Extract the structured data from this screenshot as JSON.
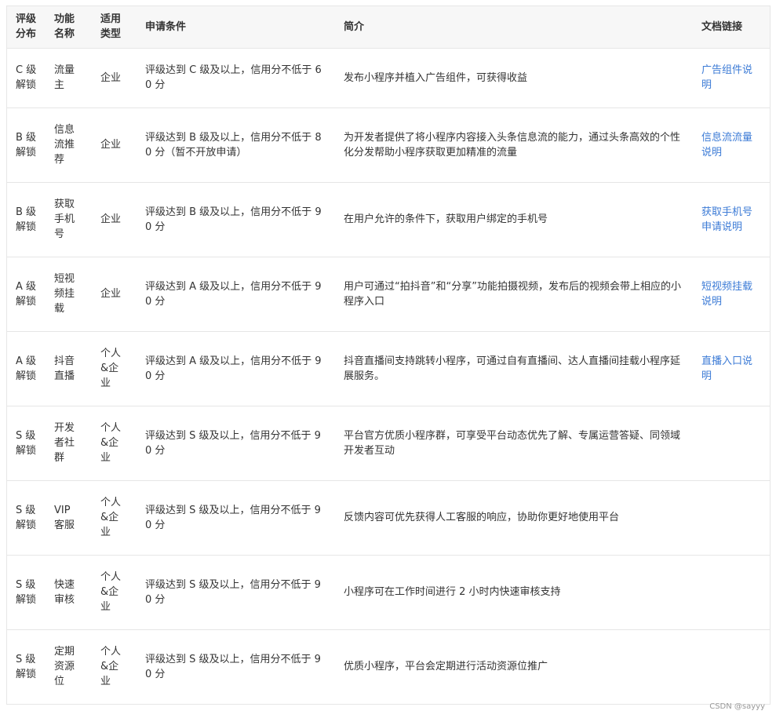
{
  "headers": [
    "评级分布",
    "功能名称",
    "适用类型",
    "申请条件",
    "简介",
    "文档链接"
  ],
  "rows": [
    {
      "level": "C 级解锁",
      "name": "流量主",
      "type": "企业",
      "condition": "评级达到 C 级及以上，信用分不低于 60 分",
      "intro": "发布小程序并植入广告组件，可获得收益",
      "link": "广告组件说明"
    },
    {
      "level": "B 级解锁",
      "name": "信息流推荐",
      "type": "企业",
      "condition": "评级达到 B 级及以上，信用分不低于 80 分（暂不开放申请）",
      "intro": "为开发者提供了将小程序内容接入头条信息流的能力，通过头条高效的个性化分发帮助小程序获取更加精准的流量",
      "link": "信息流流量说明"
    },
    {
      "level": "B 级解锁",
      "name": "获取手机号",
      "type": "企业",
      "condition": "评级达到 B 级及以上，信用分不低于 90 分",
      "intro": "在用户允许的条件下，获取用户绑定的手机号",
      "link": "获取手机号申请说明"
    },
    {
      "level": "A 级解锁",
      "name": "短视频挂载",
      "type": "企业",
      "condition": "评级达到 A 级及以上，信用分不低于 90 分",
      "intro": "用户可通过“拍抖音”和“分享”功能拍摄视频，发布后的视频会带上相应的小程序入口",
      "link": "短视频挂载说明"
    },
    {
      "level": "A 级解锁",
      "name": "抖音直播",
      "type": "个人&企业",
      "condition": "评级达到 A 级及以上，信用分不低于 90 分",
      "intro": "抖音直播间支持跳转小程序，可通过自有直播间、达人直播间挂载小程序延展服务。",
      "link": "直播入口说明"
    },
    {
      "level": "S 级解锁",
      "name": "开发者社群",
      "type": "个人&企业",
      "condition": "评级达到 S 级及以上，信用分不低于 90 分",
      "intro": "平台官方优质小程序群，可享受平台动态优先了解、专属运营答疑、同领域开发者互动",
      "link": ""
    },
    {
      "level": "S 级解锁",
      "name": "VIP 客服",
      "type": "个人&企业",
      "condition": "评级达到 S 级及以上，信用分不低于 90 分",
      "intro": "反馈内容可优先获得人工客服的响应，协助你更好地使用平台",
      "link": ""
    },
    {
      "level": "S 级解锁",
      "name": "快速审核",
      "type": "个人&企业",
      "condition": "评级达到 S 级及以上，信用分不低于 90 分",
      "intro": "小程序可在工作时间进行 2 小时内快速审核支持",
      "link": ""
    },
    {
      "level": "S 级解锁",
      "name": "定期资源位",
      "type": "个人&企业",
      "condition": "评级达到 S 级及以上，信用分不低于 90 分",
      "intro": "优质小程序，平台会定期进行活动资源位推广",
      "link": ""
    }
  ],
  "watermark": "CSDN @sayyy"
}
